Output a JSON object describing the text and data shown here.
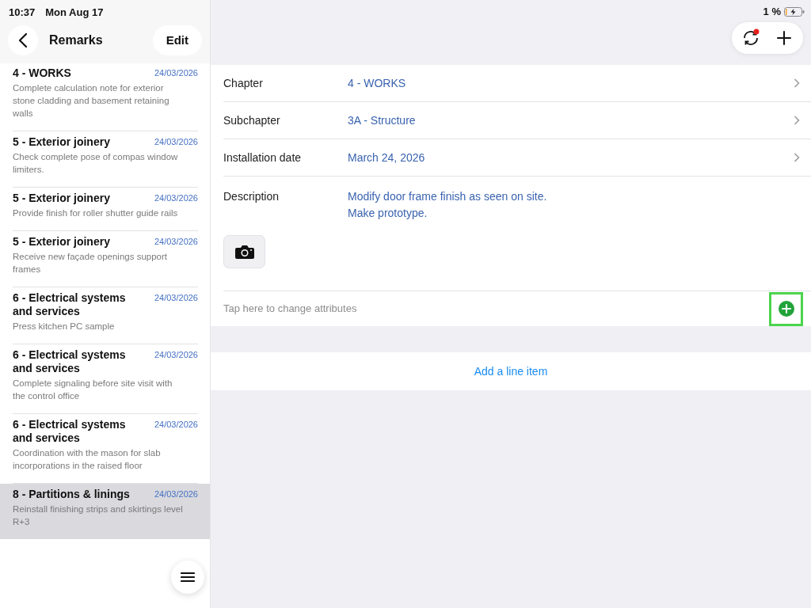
{
  "status_bar": {
    "time": "10:37",
    "date": "Mon Aug 17",
    "battery": "1 %"
  },
  "sidebar": {
    "title": "Remarks",
    "edit_button": "Edit",
    "items": [
      {
        "title": "4 - WORKS",
        "date": "24/03/2026",
        "description": "Complete calculation note for exterior stone cladding and basement retaining walls",
        "selected": false
      },
      {
        "title": "5 - Exterior joinery",
        "date": "24/03/2026",
        "description": "Check complete pose of compas window limiters.",
        "selected": false
      },
      {
        "title": "5 - Exterior joinery",
        "date": "24/03/2026",
        "description": "Provide finish for roller shutter guide rails",
        "selected": false
      },
      {
        "title": "5 - Exterior joinery",
        "date": "24/03/2026",
        "description": "Receive new façade openings support frames",
        "selected": false
      },
      {
        "title": "6 - Electrical systems and services",
        "date": "24/03/2026",
        "description": "Press kitchen PC sample",
        "selected": false
      },
      {
        "title": "6 - Electrical systems and services",
        "date": "24/03/2026",
        "description": "Complete signaling before site visit with the control office",
        "selected": false
      },
      {
        "title": "6 - Electrical systems and services",
        "date": "24/03/2026",
        "description": "Coordination with the mason for slab incorporations in the raised floor",
        "selected": false
      },
      {
        "title": "8 - Partitions & linings",
        "date": "24/03/2026",
        "description": "Reinstall finishing strips and skirtings level R+3",
        "selected": true
      }
    ]
  },
  "toolbar": {
    "sync_pending": true
  },
  "form": {
    "fields": [
      {
        "label": "Chapter",
        "value": "4 - WORKS"
      },
      {
        "label": "Subchapter",
        "value": "3A - Structure"
      },
      {
        "label": "Installation date",
        "value": "March 24, 2026"
      }
    ],
    "description": {
      "label": "Description",
      "lines": [
        "Modify door frame finish as seen on site.",
        "Make prototype."
      ]
    },
    "attributes": {
      "placeholder": "Tap here to change attributes",
      "highlighted": true
    },
    "add_line_item": "Add a line item"
  }
}
